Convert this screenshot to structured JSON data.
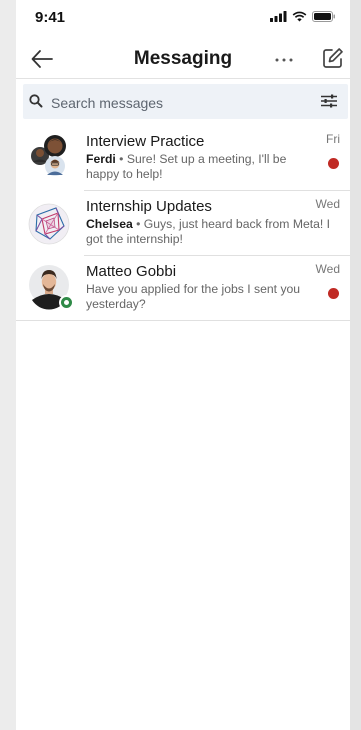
{
  "status_bar": {
    "time": "9:41"
  },
  "header": {
    "title": "Messaging"
  },
  "search": {
    "placeholder": "Search messages"
  },
  "conversations": [
    {
      "name": "Interview Practice",
      "time": "Fri",
      "sender": "Ferdi",
      "separator": " • ",
      "preview": "Sure! Set up a meeting, I'll be happy to help!",
      "unread": true
    },
    {
      "name": "Internship Updates",
      "time": "Wed",
      "sender": "Chelsea",
      "separator": " • ",
      "preview": "Guys, just heard back from Meta! I got the internship!",
      "unread": false
    },
    {
      "name": "Matteo Gobbi",
      "time": "Wed",
      "preview": "Have you applied for the jobs I sent you yesterday?",
      "unread": true
    }
  ],
  "colors": {
    "unread": "#c02a24",
    "online": "#2f8a47",
    "search_bg": "#eef2f7"
  }
}
